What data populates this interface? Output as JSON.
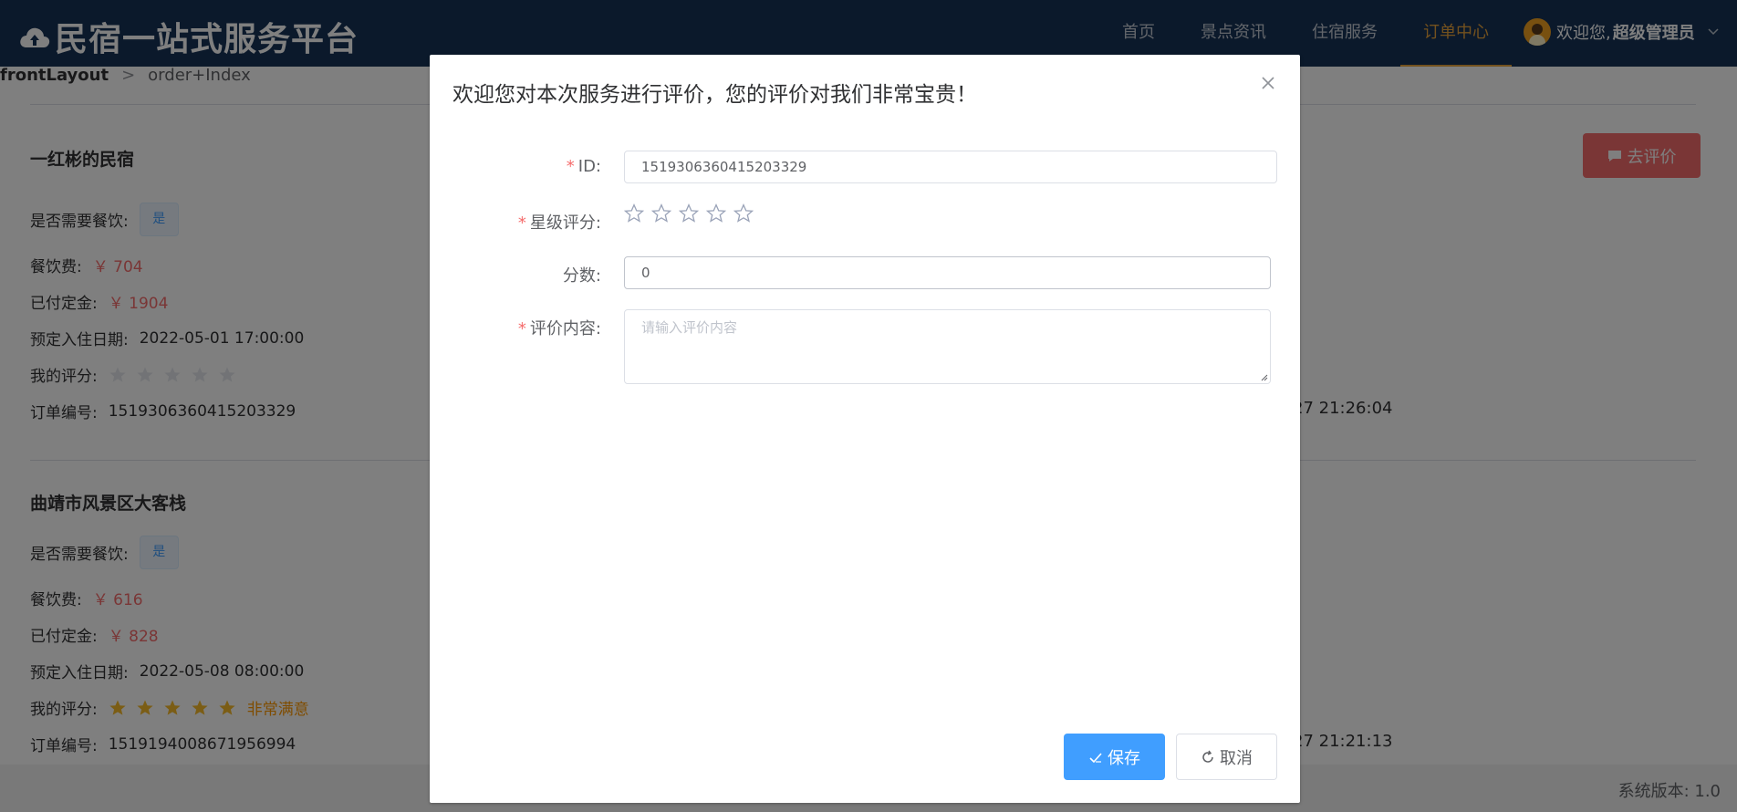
{
  "header": {
    "brand": "民宿一站式服务平台",
    "nav": [
      "首页",
      "景点资讯",
      "住宿服务",
      "订单中心"
    ],
    "active_nav": "订单中心",
    "user_greeting": "欢迎您,",
    "user_name": "超级管理员",
    "colors": {
      "bg": "#173257",
      "active": "#e6a23c"
    }
  },
  "breadcrumb": {
    "root": "frontLayout",
    "current": "order+Index"
  },
  "orders": [
    {
      "name": "一红彬的民宿",
      "need_meal_label": "是否需要餐饮:",
      "need_meal_value": "是",
      "meal_fee_label": "餐饮费:",
      "meal_fee_value": "￥ 704",
      "deposit_label": "已付定金:",
      "deposit_value": "￥ 1904",
      "checkin_label": "预定入住日期:",
      "checkin_value": "2022-05-01 17:00:00",
      "rating_label": "我的评分:",
      "rating": 0,
      "rating_text": "",
      "order_no_label": "订单编号:",
      "order_no_value": "1519306360415203329",
      "right_time": "27 21:26:04"
    },
    {
      "name": "曲靖市风景区大客栈",
      "need_meal_label": "是否需要餐饮:",
      "need_meal_value": "是",
      "meal_fee_label": "餐饮费:",
      "meal_fee_value": "￥ 616",
      "deposit_label": "已付定金:",
      "deposit_value": "￥ 828",
      "checkin_label": "预定入住日期:",
      "checkin_value": "2022-05-08 08:00:00",
      "rating_label": "我的评分:",
      "rating": 5,
      "rating_text": "非常满意",
      "order_no_label": "订单编号:",
      "order_no_value": "1519194008671956994",
      "right_time": "27 21:21:13"
    }
  ],
  "comment_button": "去评价",
  "footer": {
    "version": "系统版本:  1.0"
  },
  "dialog": {
    "title": "欢迎您对本次服务进行评价，您的评价对我们非常宝贵！",
    "fields": {
      "id": {
        "label": "ID:",
        "value": "1519306360415203329"
      },
      "stars": {
        "label": "星级评分:",
        "value": 0,
        "max": 5
      },
      "score": {
        "label": "分数:",
        "value": "0"
      },
      "content": {
        "label": "评价内容:",
        "placeholder": "请输入评价内容"
      }
    },
    "save": "保存",
    "cancel": "取消"
  }
}
